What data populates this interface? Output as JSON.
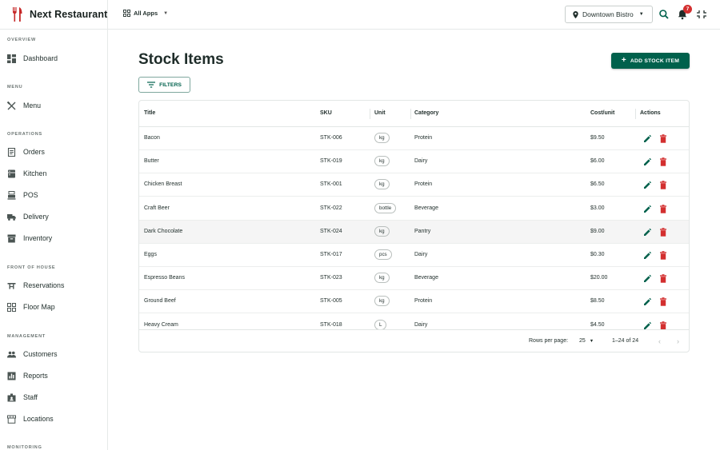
{
  "app": {
    "name": "Next Restaurant"
  },
  "topbar": {
    "apps_label": "All Apps",
    "location": "Downtown Bistro",
    "notification_count": "7"
  },
  "sidebar": {
    "sections": [
      {
        "title": "OVERVIEW",
        "items": [
          {
            "label": "Dashboard",
            "icon": "dashboard-icon"
          }
        ]
      },
      {
        "title": "MENU",
        "items": [
          {
            "label": "Menu",
            "icon": "utensils-icon"
          }
        ]
      },
      {
        "title": "OPERATIONS",
        "items": [
          {
            "label": "Orders",
            "icon": "receipt-icon"
          },
          {
            "label": "Kitchen",
            "icon": "kitchen-icon"
          },
          {
            "label": "POS",
            "icon": "register-icon"
          },
          {
            "label": "Delivery",
            "icon": "truck-icon"
          },
          {
            "label": "Inventory",
            "icon": "archive-icon"
          }
        ]
      },
      {
        "title": "FRONT OF HOUSE",
        "items": [
          {
            "label": "Reservations",
            "icon": "table-restaurant-icon"
          },
          {
            "label": "Floor Map",
            "icon": "grid-icon"
          }
        ]
      },
      {
        "title": "MANAGEMENT",
        "items": [
          {
            "label": "Customers",
            "icon": "people-icon"
          },
          {
            "label": "Reports",
            "icon": "chart-icon"
          },
          {
            "label": "Staff",
            "icon": "badge-icon"
          },
          {
            "label": "Locations",
            "icon": "store-icon"
          }
        ]
      },
      {
        "title": "MONITORING",
        "items": []
      }
    ]
  },
  "page": {
    "title": "Stock Items",
    "add_label": "ADD STOCK ITEM",
    "filters_label": "FILTERS"
  },
  "table": {
    "columns": [
      "Title",
      "SKU",
      "Unit",
      "Category",
      "Cost/unit",
      "Actions"
    ],
    "rows": [
      {
        "title": "Bacon",
        "sku": "STK-006",
        "unit": "kg",
        "category": "Protein",
        "cost": "$9.50"
      },
      {
        "title": "Butter",
        "sku": "STK-019",
        "unit": "kg",
        "category": "Dairy",
        "cost": "$6.00"
      },
      {
        "title": "Chicken Breast",
        "sku": "STK-001",
        "unit": "kg",
        "category": "Protein",
        "cost": "$6.50"
      },
      {
        "title": "Craft Beer",
        "sku": "STK-022",
        "unit": "bottle",
        "category": "Beverage",
        "cost": "$3.00"
      },
      {
        "title": "Dark Chocolate",
        "sku": "STK-024",
        "unit": "kg",
        "category": "Pantry",
        "cost": "$9.00"
      },
      {
        "title": "Eggs",
        "sku": "STK-017",
        "unit": "pcs",
        "category": "Dairy",
        "cost": "$0.30"
      },
      {
        "title": "Espresso Beans",
        "sku": "STK-023",
        "unit": "kg",
        "category": "Beverage",
        "cost": "$20.00"
      },
      {
        "title": "Ground Beef",
        "sku": "STK-005",
        "unit": "kg",
        "category": "Protein",
        "cost": "$8.50"
      },
      {
        "title": "Heavy Cream",
        "sku": "STK-018",
        "unit": "L",
        "category": "Dairy",
        "cost": "$4.50"
      }
    ],
    "highlighted_row": 4,
    "footer": {
      "rows_per_page_label": "Rows per page:",
      "rows_per_page": "25",
      "range": "1–24 of 24"
    }
  },
  "colors": {
    "primary": "#00614c",
    "danger": "#d32f2f",
    "badge": "#d32f2f"
  }
}
